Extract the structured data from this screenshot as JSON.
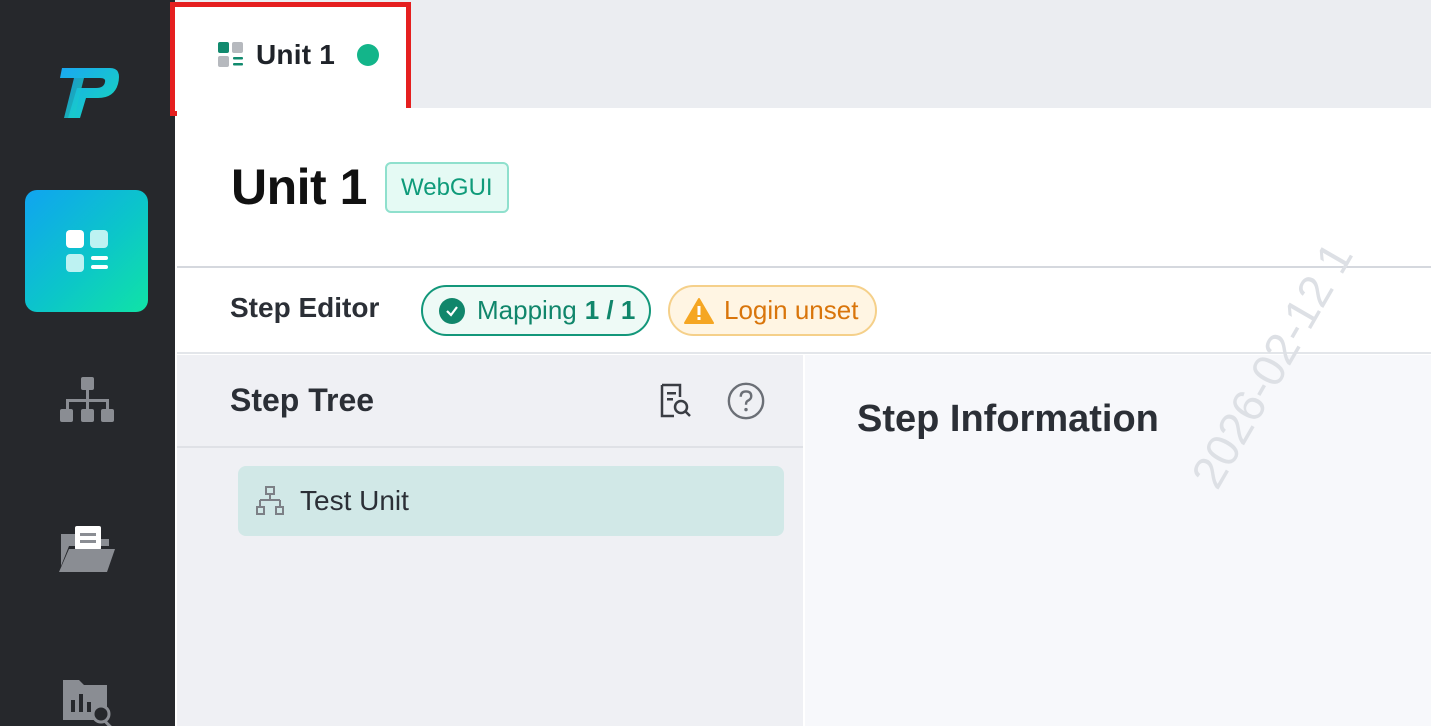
{
  "tab": {
    "title": "Unit 1",
    "status_color": "#13b58a"
  },
  "header": {
    "title": "Unit 1",
    "type_badge": "WebGUI"
  },
  "editor": {
    "label": "Step Editor",
    "mapping": {
      "label": "Mapping",
      "count": "1 / 1"
    },
    "login": {
      "label": "Login unset"
    }
  },
  "tree": {
    "title": "Step Tree",
    "items": [
      {
        "label": "Test Unit"
      }
    ]
  },
  "info": {
    "title": "Step Information"
  },
  "watermark": "2026-02-12 1",
  "colors": {
    "accent": "#13b58a",
    "warning": "#d9750b",
    "highlight": "#e51f1f"
  }
}
